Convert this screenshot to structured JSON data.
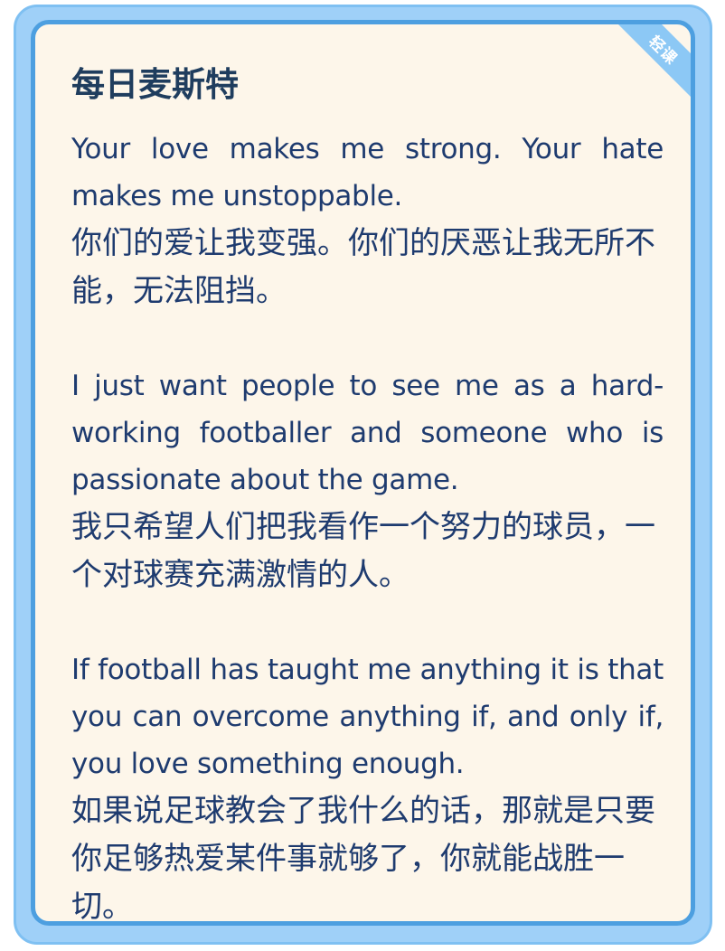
{
  "card": {
    "title": "每日麦斯特",
    "tag": "轻课"
  },
  "quotes": [
    {
      "en": "Your love makes me strong. Your hate makes me unstoppable.",
      "zh": "你们的爱让我变强。你们的厌恶让我无所不能，无法阻挡。"
    },
    {
      "en": "I just want people to see me as a hard-working footballer and someone who is passionate about the game.",
      "zh": "我只希望人们把我看作一个努力的球员，一个对球赛充满激情的人。"
    },
    {
      "en": "If football has taught me anything it is that you can overcome anything if, and only if, you love something enough.",
      "zh": "如果说足球教会了我什么的话，那就是只要你足够热爱某件事就够了，你就能战胜一切。"
    }
  ],
  "colors": {
    "outer_frame": "#9fd0f8",
    "card_border": "#4d9fe0",
    "card_background": "#fdf6ea",
    "text": "#1e3b6f",
    "tag_background": "#8cc8f5"
  }
}
